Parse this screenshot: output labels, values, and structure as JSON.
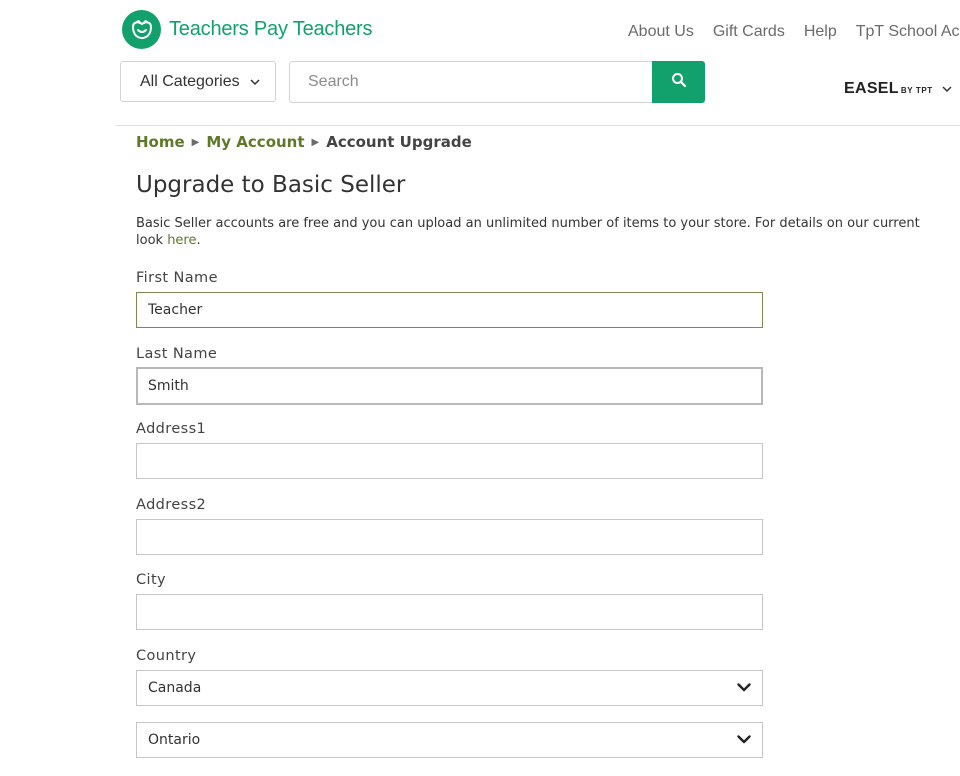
{
  "header": {
    "brand": "Teachers Pay Teachers",
    "nav": [
      "About Us",
      "Gift Cards",
      "Help",
      "TpT School Ac"
    ],
    "categories_label": "All Categories",
    "search_placeholder": "Search",
    "easel_main": "EASEL",
    "easel_sub": "BY TPT"
  },
  "breadcrumb": {
    "home": "Home",
    "account": "My Account",
    "current": "Account Upgrade"
  },
  "page": {
    "title": "Upgrade to Basic Seller",
    "desc_line1": "Basic Seller accounts are free and you can upload an unlimited number of items to your store. For details on our current",
    "desc_pre": "look ",
    "desc_link": "here",
    "desc_post": "."
  },
  "form": {
    "first_name_label": "First Name",
    "first_name_value": "Teacher",
    "last_name_label": "Last Name",
    "last_name_value": "Smith",
    "address1_label": "Address1",
    "address1_value": "",
    "address2_label": "Address2",
    "address2_value": "",
    "city_label": "City",
    "city_value": "",
    "country_label": "Country",
    "country_value": "Canada",
    "province_value": "Ontario"
  },
  "colors": {
    "brand_green": "#12a16c",
    "link_olive": "#5e7a29"
  },
  "icons": {
    "logo": "tpt-apple-face-icon",
    "search": "search-icon",
    "chevron": "chevron-down-icon"
  }
}
